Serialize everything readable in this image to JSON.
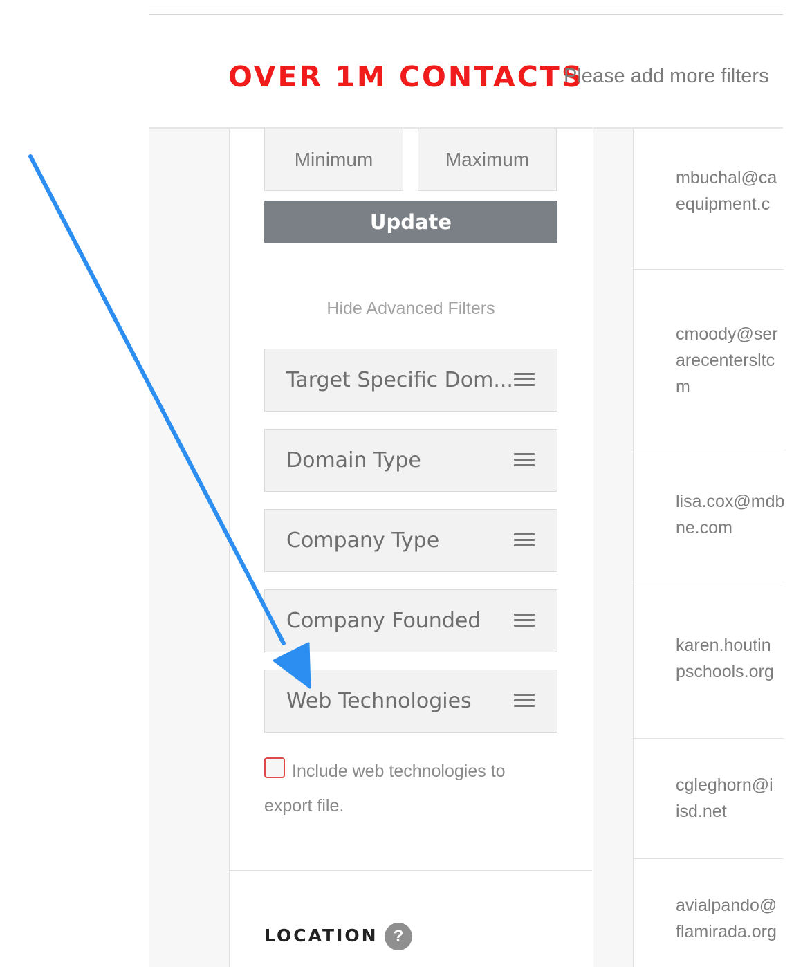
{
  "header": {
    "headline": "OVER 1M CONTACTS",
    "subhead": "Please add more filters"
  },
  "range": {
    "min_placeholder": "Minimum",
    "max_placeholder": "Maximum",
    "update_label": "Update"
  },
  "advanced": {
    "hide_label": "Hide Advanced Filters",
    "filters": [
      {
        "label": "Target Specific Dom..."
      },
      {
        "label": "Domain Type"
      },
      {
        "label": "Company Type"
      },
      {
        "label": "Company Founded"
      },
      {
        "label": "Web Technologies"
      }
    ],
    "include_checkbox_label": "Include web technologies to export file.",
    "include_checked": false
  },
  "location": {
    "title": "LOCATION",
    "help": "?"
  },
  "results": {
    "emails": [
      "mbuchal@caequipment.c",
      "cmoody@serarecentersltcm",
      "lisa.cox@mdbne.com",
      "karen.houtinpschools.org",
      "cgleghorn@iisd.net",
      "avialpando@flamirada.org"
    ],
    "email_lines": [
      [
        "mbuchal@ca",
        "equipment.c"
      ],
      [
        "cmoody@ser",
        "arecentersltc",
        "m"
      ],
      [
        "lisa.cox@mdb",
        "ne.com"
      ],
      [
        "karen.houtin",
        "pschools.org"
      ],
      [
        "cgleghorn@i",
        "isd.net"
      ],
      [
        "avialpando@",
        "flamirada.org"
      ]
    ]
  },
  "colors": {
    "headline": "#f01b1b",
    "update_button": "#7b8086",
    "arrow": "#2b8ef0",
    "checkbox_border": "#e04848"
  },
  "annotation": {
    "arrow_icon": "arrow-annotation-icon"
  }
}
